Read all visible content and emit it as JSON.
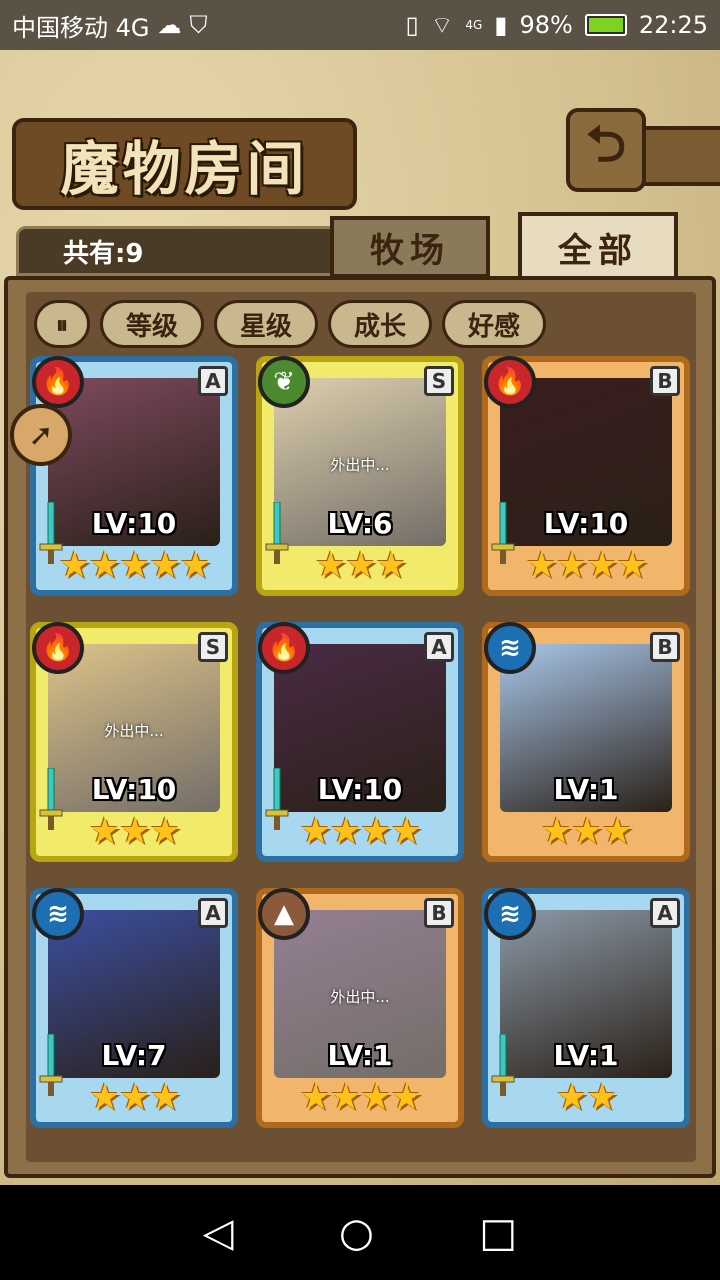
{
  "status": {
    "carrier": "中国移动 4G",
    "battery": "98%",
    "time": "22:25",
    "net": "4G"
  },
  "header": {
    "title": "魔物房间",
    "back_icon": "back-arrow-icon"
  },
  "tabs": {
    "count_label": "共有:9",
    "ranch": "牧场",
    "all": "全部"
  },
  "filters": {
    "sort_icon": "sort-icon",
    "level": "等级",
    "stars": "星级",
    "growth": "成长",
    "affinity": "好感"
  },
  "cards": [
    {
      "lv": "LV:10",
      "stars": "★★★★★",
      "grade": "A",
      "element": "fire",
      "frame": "blue",
      "away": ""
    },
    {
      "lv": "LV:6",
      "stars": "★★★",
      "grade": "S",
      "element": "grass",
      "frame": "yellow",
      "away": "外出中..."
    },
    {
      "lv": "LV:10",
      "stars": "★★★★",
      "grade": "B",
      "element": "fire",
      "frame": "orange",
      "away": ""
    },
    {
      "lv": "LV:10",
      "stars": "★★★",
      "grade": "S",
      "element": "fire",
      "frame": "yellow",
      "away": "外出中..."
    },
    {
      "lv": "LV:10",
      "stars": "★★★★",
      "grade": "A",
      "element": "fire",
      "frame": "blue",
      "away": ""
    },
    {
      "lv": "LV:1",
      "stars": "★★★",
      "grade": "B",
      "element": "water",
      "frame": "orange",
      "away": ""
    },
    {
      "lv": "LV:7",
      "stars": "★★★",
      "grade": "A",
      "element": "water",
      "frame": "blue",
      "away": ""
    },
    {
      "lv": "LV:1",
      "stars": "★★★★",
      "grade": "B",
      "element": "earth",
      "frame": "orange",
      "away": "外出中..."
    },
    {
      "lv": "LV:1",
      "stars": "★★",
      "grade": "A",
      "element": "water",
      "frame": "blue",
      "away": ""
    }
  ]
}
